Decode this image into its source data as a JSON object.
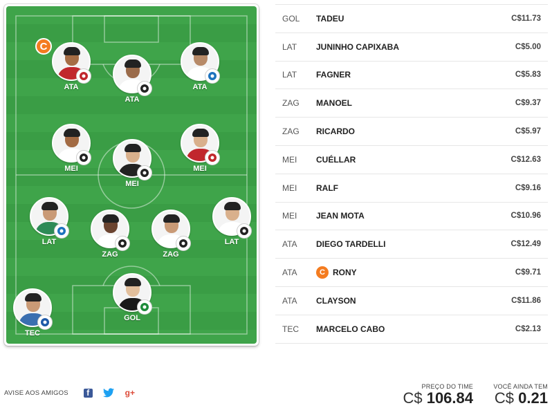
{
  "field": {
    "players": [
      {
        "id": "rony",
        "pos": "ATA",
        "skin": "#a56d45",
        "shirt": "#c1272d",
        "crest_color": "#c1272d",
        "captain": true
      },
      {
        "id": "clayson",
        "pos": "ATA",
        "skin": "#9a6b4a",
        "shirt": "#ffffff",
        "crest_color": "#222222"
      },
      {
        "id": "diego-tardelli",
        "pos": "ATA",
        "skin": "#b78a68",
        "shirt": "#ffffff",
        "crest_color": "#1e73be"
      },
      {
        "id": "jean-mota",
        "pos": "MEI",
        "skin": "#a36b44",
        "shirt": "#ffffff",
        "crest_color": "#222222"
      },
      {
        "id": "ralf",
        "pos": "MEI",
        "skin": "#d9b08c",
        "shirt": "#222222",
        "crest_color": "#222222"
      },
      {
        "id": "cuellar",
        "pos": "MEI",
        "skin": "#d9b08c",
        "shirt": "#c1272d",
        "crest_color": "#c1272d"
      },
      {
        "id": "fagner",
        "pos": "LAT",
        "skin": "#c99a76",
        "shirt": "#2e8b57",
        "crest_color": "#1e73be"
      },
      {
        "id": "ricardo",
        "pos": "ZAG",
        "skin": "#6b4430",
        "shirt": "#ffffff",
        "crest_color": "#222222"
      },
      {
        "id": "manoel",
        "pos": "ZAG",
        "skin": "#c99a76",
        "shirt": "#ffffff",
        "crest_color": "#222222"
      },
      {
        "id": "juninho-capixaba",
        "pos": "LAT",
        "skin": "#d9b08c",
        "shirt": "#ffffff",
        "crest_color": "#222222"
      },
      {
        "id": "tadeu",
        "pos": "GOL",
        "skin": "#e2bf9c",
        "shirt": "#1a1a1a",
        "crest_color": "#1e8c3a"
      },
      {
        "id": "marcelo-cabo",
        "pos": "TEC",
        "skin": "#c99a76",
        "shirt": "#3a6fb0",
        "crest_color": "#1e5aa8"
      }
    ]
  },
  "captain_symbol": "C",
  "list": [
    {
      "pos": "GOL",
      "name": "TADEU",
      "price": "C$11.73"
    },
    {
      "pos": "LAT",
      "name": "JUNINHO CAPIXABA",
      "price": "C$5.00"
    },
    {
      "pos": "LAT",
      "name": "FAGNER",
      "price": "C$5.83"
    },
    {
      "pos": "ZAG",
      "name": "MANOEL",
      "price": "C$9.37"
    },
    {
      "pos": "ZAG",
      "name": "RICARDO",
      "price": "C$5.97"
    },
    {
      "pos": "MEI",
      "name": "CUÉLLAR",
      "price": "C$12.63"
    },
    {
      "pos": "MEI",
      "name": "RALF",
      "price": "C$9.16"
    },
    {
      "pos": "MEI",
      "name": "JEAN MOTA",
      "price": "C$10.96"
    },
    {
      "pos": "ATA",
      "name": "DIEGO TARDELLI",
      "price": "C$12.49"
    },
    {
      "pos": "ATA",
      "name": "RONY",
      "price": "C$9.71",
      "captain": true
    },
    {
      "pos": "ATA",
      "name": "CLAYSON",
      "price": "C$11.86"
    },
    {
      "pos": "TEC",
      "name": "MARCELO CABO",
      "price": "C$2.13"
    }
  ],
  "footer": {
    "share_label": "AVISE AOS AMIGOS",
    "facebook_glyph": "f",
    "twitter_glyph": "🐦",
    "googleplus_glyph": "g+",
    "team_price_label": "PREÇO DO TIME",
    "team_price_currency": "C$",
    "team_price_value": "106.84",
    "remaining_label": "VOCÊ AINDA TEM",
    "remaining_currency": "C$",
    "remaining_value": "0.21"
  },
  "colors": {
    "captain": "#f47c20",
    "field_dark": "#3a9d45",
    "field_light": "#3fa44a"
  }
}
